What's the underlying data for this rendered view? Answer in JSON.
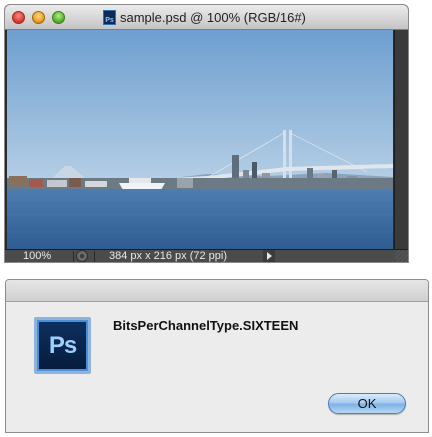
{
  "document_window": {
    "title": "sample.psd @ 100% (RGB/16#)",
    "title_icon_text": "Ps",
    "status": {
      "zoom": "100%",
      "doc_info": "384 px x 216 px (72 ppi)"
    }
  },
  "dialog": {
    "message": "BitsPerChannelType.SIXTEEN",
    "icon_text": "Ps",
    "ok_label": "OK"
  },
  "colors": {
    "sky": "#9dbfdc",
    "water": "#3f6c9f",
    "ok_button": "#7fb2e6"
  }
}
